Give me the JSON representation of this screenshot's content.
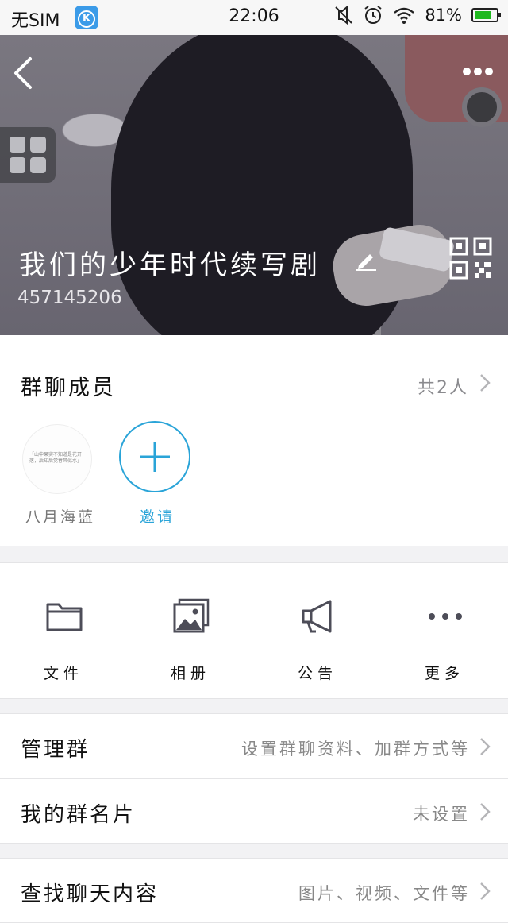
{
  "status_bar": {
    "carrier": "无SIM",
    "app_icon_letter": "K",
    "time": "22:06",
    "battery": "81%",
    "battery_level": 0.81
  },
  "header": {
    "group_name": "我们的少年时代续写剧",
    "group_id": "457145206"
  },
  "members": {
    "label": "群聊成员",
    "count": "共2人",
    "items": [
      {
        "name": "八月海蓝",
        "avatar_text": "「山中果实不知道是花开落，后知后觉春风似水」"
      }
    ],
    "invite_label": "邀请"
  },
  "tools": [
    {
      "label": "文件",
      "icon": "folder-icon"
    },
    {
      "label": "相册",
      "icon": "album-icon"
    },
    {
      "label": "公告",
      "icon": "megaphone-icon"
    },
    {
      "label": "更多",
      "icon": "more-dots-icon"
    }
  ],
  "rows": [
    {
      "label": "管理群",
      "value": "设置群聊资料、加群方式等"
    },
    {
      "label": "我的群名片",
      "value": "未设置"
    },
    {
      "label": "查找聊天内容",
      "value": "图片、视频、文件等"
    }
  ],
  "colors": {
    "accent": "#2aa4d8",
    "battery": "#1fb81f",
    "app_icon": "#3b9be8"
  }
}
